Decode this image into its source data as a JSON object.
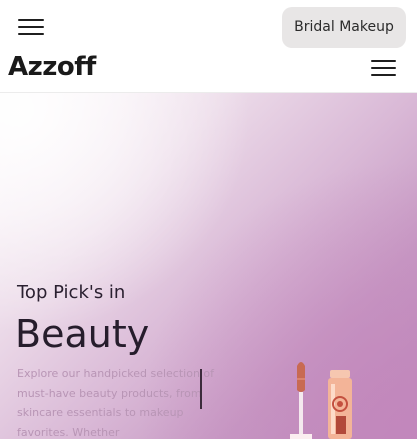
{
  "topbar": {
    "menu_icon": "hamburger-menu-icon",
    "cta_label": "Bridal Makeup"
  },
  "nav": {
    "logo_text": "Azzoff",
    "menu_icon": "hamburger-menu-icon"
  },
  "hero": {
    "kicker": "Top Pick's in",
    "title": "Beauty",
    "description": "Explore our handpicked selection of must-have beauty products, from skincare essentials to makeup favorites. Whether",
    "product_icon": "lip-gloss-icon"
  },
  "colors": {
    "cta_bg": "#e8e6e6",
    "logo": "#1a1a1a",
    "hero_purple": "#c79ac4",
    "hero_text": "#261d2c",
    "desc_text": "#b895b5"
  }
}
